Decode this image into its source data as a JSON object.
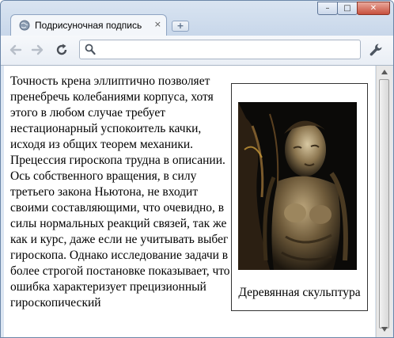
{
  "tab": {
    "title": "Подрисуночная подпись",
    "close_glyph": "×",
    "new_tab_glyph": "+"
  },
  "window": {
    "minimize_glyph": "–",
    "maximize_glyph": "□",
    "close_glyph": "✕"
  },
  "address_bar": {
    "value": "",
    "placeholder": ""
  },
  "article": {
    "text": "Точность крена эллиптично позволяет пренебречь колебаниями корпуса, хотя этого в любом случае требует нестационарный успокоитель качки, исходя из общих теорем механики. Прецессия гироскопа трудна в описании. Ось собственного вращения, в силу третьего закона Ньютона, не входит своими составляющими, что очевидно, в силы нормальных реакций связей, так же как и курс, даже если не учитывать выбег гироскопа. Однако исследование задачи в более строгой постановке показывает, что ошибка характеризует прецизионный гироскопический"
  },
  "figure": {
    "caption": "Деревянная скульптура"
  },
  "colors": {
    "frame": "#c8d7ea",
    "close_button": "#c7503d",
    "photo_bg": "#0b0a08"
  }
}
